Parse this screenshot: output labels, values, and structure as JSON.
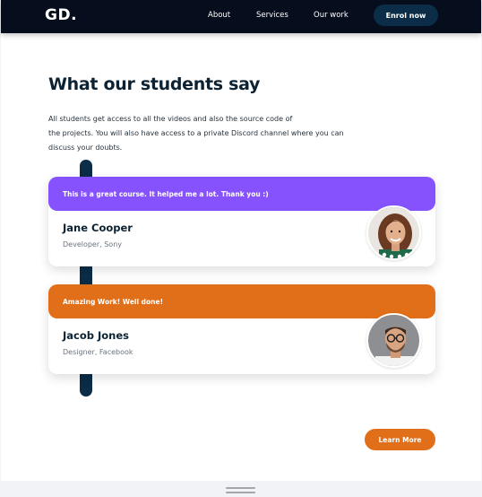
{
  "nav": {
    "logo": "GD.",
    "links": [
      "About",
      "Services",
      "Our work"
    ],
    "cta": "Enrol now"
  },
  "section": {
    "title": "What our students say",
    "intro_lines": [
      "All students get access to all the videos and also the source code of",
      "the projects. You will also have access to a private Discord channel where you can",
      "discuss your doubts."
    ]
  },
  "testimonials": [
    {
      "quote": "This is a great course. It helped me a lot. Thank you :)",
      "name": "Jane Cooper",
      "role": "Developer, Sony",
      "accent": "#8652fd"
    },
    {
      "quote": "Amazing Work! Well done!",
      "name": "Jacob Jones",
      "role": "Designer, Facebook",
      "accent": "#e16e19"
    }
  ],
  "cta_secondary": "Learn More",
  "colors": {
    "navy": "#0b2d47",
    "nav_bg": "#060d1c",
    "purple": "#8652fd",
    "orange": "#e16e19"
  }
}
